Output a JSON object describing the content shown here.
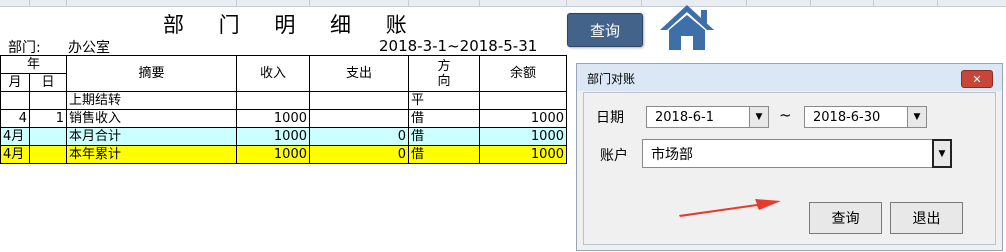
{
  "ledger": {
    "title": "部 门 明 细 账",
    "department_label": "部门:",
    "department_value": "办公室",
    "period": "2018-3-1~2018-5-31",
    "headers": {
      "year": "年",
      "month": "月",
      "day": "日",
      "summary": "摘要",
      "income": "收入",
      "expense": "支出",
      "direction_1": "方",
      "direction_2": "向",
      "balance": "余额"
    },
    "rows": [
      {
        "month": "",
        "day": "",
        "summary": "上期结转",
        "income": "",
        "expense": "",
        "direction": "平",
        "balance": ""
      },
      {
        "month": "4",
        "day": "1",
        "summary": "销售收入",
        "income": "1000",
        "expense": "",
        "direction": "借",
        "balance": "1000"
      },
      {
        "month": "4月",
        "day": "",
        "summary": "本月合计",
        "income": "1000",
        "expense": "0",
        "direction": "借",
        "balance": "1000"
      },
      {
        "month": "4月",
        "day": "",
        "summary": "本年累计",
        "income": "1000",
        "expense": "0",
        "direction": "借",
        "balance": "1000"
      }
    ]
  },
  "toolbar": {
    "query_label": "查询",
    "home_icon": "home-icon"
  },
  "dialog": {
    "title": "部门对账",
    "close_icon": "close-icon",
    "date_label": "日期",
    "start_date": "2018-6-1",
    "range_sep": "~",
    "end_date": "2018-6-30",
    "account_label": "账户",
    "account_value": "市场部",
    "dropdown_icon": "chevron-down-icon",
    "query_label": "查询",
    "exit_label": "退出"
  },
  "colors": {
    "cyan_row": "#ccffff",
    "yellow_row": "#ffff00",
    "button_blue": "#44638a",
    "home_blue": "#3e6fa9",
    "arrow_red": "#e63b2e"
  }
}
